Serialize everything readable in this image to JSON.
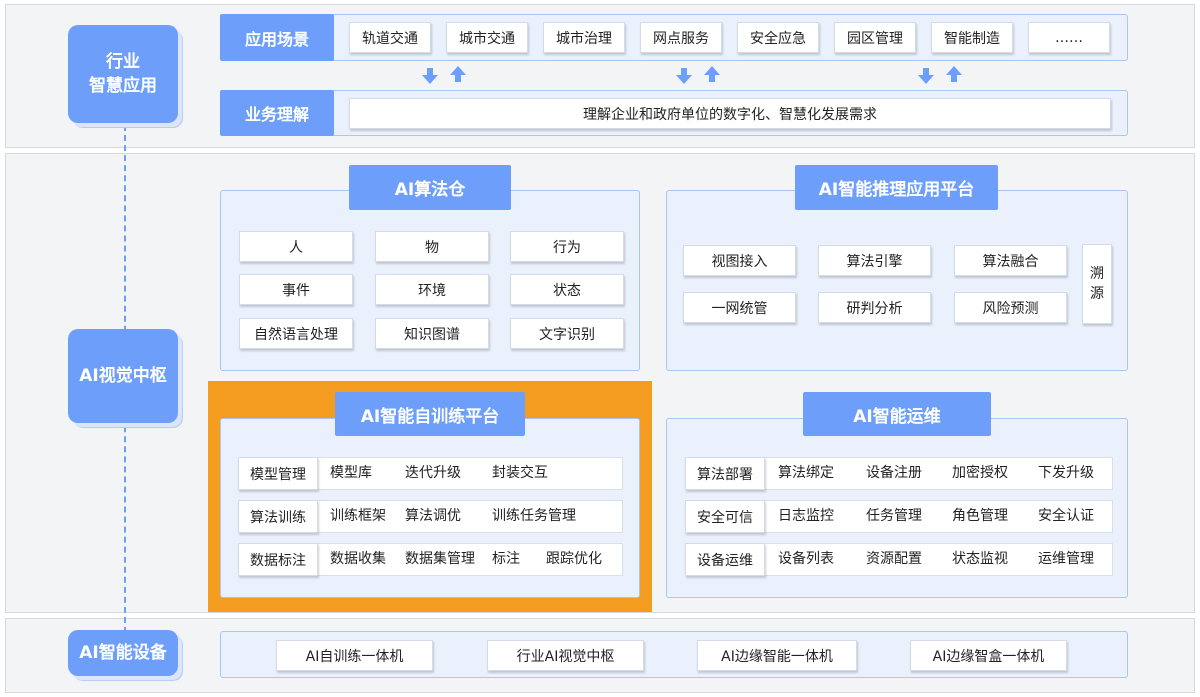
{
  "left_labels": {
    "industry": "行业\n智慧应用",
    "vision": "AI视觉中枢",
    "device": "AI智能设备"
  },
  "scenario": {
    "title": "应用场景",
    "items": [
      "轨道交通",
      "城市交通",
      "城市治理",
      "网点服务",
      "安全应急",
      "园区管理",
      "智能制造",
      "……"
    ]
  },
  "business": {
    "title": "业务理解",
    "text": "理解企业和政府单位的数字化、智慧化发展需求"
  },
  "algo_warehouse": {
    "title": "AI算法仓",
    "items": [
      "人",
      "物",
      "行为",
      "事件",
      "环境",
      "状态",
      "自然语言处理",
      "知识图谱",
      "文字识别"
    ]
  },
  "inference": {
    "title": "AI智能推理应用平台",
    "items": [
      "视图接入",
      "算法引擎",
      "算法融合",
      "一网统管",
      "研判分析",
      "风险预测"
    ],
    "side": "溯\n源"
  },
  "training": {
    "title": "AI智能自训练平台",
    "rows": [
      {
        "head": "模型管理",
        "cells": [
          "模型库",
          "迭代升级",
          "封装交互"
        ]
      },
      {
        "head": "算法训练",
        "cells": [
          "训练框架",
          "算法调优",
          "训练任务管理"
        ]
      },
      {
        "head": "数据标注",
        "cells": [
          "数据收集",
          "数据集管理",
          "标注",
          "跟踪优化"
        ]
      }
    ]
  },
  "ops": {
    "title": "AI智能运维",
    "rows": [
      {
        "head": "算法部署",
        "cells": [
          "算法绑定",
          "设备注册",
          "加密授权",
          "下发升级"
        ]
      },
      {
        "head": "安全可信",
        "cells": [
          "日志监控",
          "任务管理",
          "角色管理",
          "安全认证"
        ]
      },
      {
        "head": "设备运维",
        "cells": [
          "设备列表",
          "资源配置",
          "状态监视",
          "运维管理"
        ]
      }
    ]
  },
  "devices": {
    "items": [
      "AI自训练一体机",
      "行业AI视觉中枢",
      "AI边缘智能一体机",
      "AI边缘智盒一体机"
    ]
  },
  "colors": {
    "accent": "#6d9ffa",
    "highlight": "#f39c1f",
    "panel": "#eaf1fc"
  }
}
